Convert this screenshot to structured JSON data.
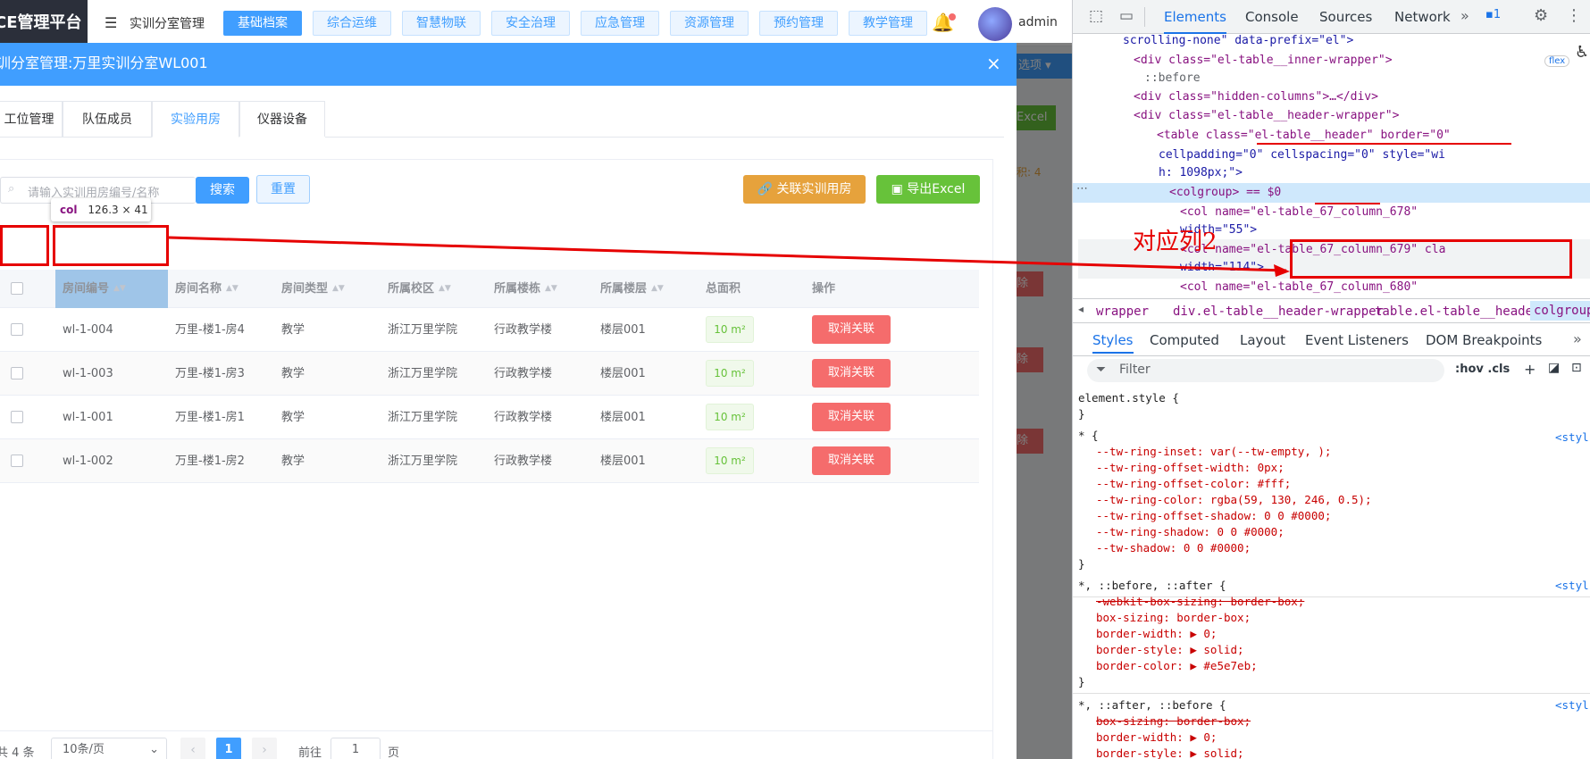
{
  "topbar": {
    "logo": "CE管理平台",
    "module": "实训分室管理",
    "nav": [
      "基础档案",
      "综合运维",
      "智慧物联",
      "安全治理",
      "应急管理",
      "资源管理",
      "预约管理",
      "教学管理"
    ],
    "user": "admin"
  },
  "dialog": {
    "title": "训分室管理:万里实训分室WL001",
    "tabs": [
      "工位管理",
      "队伍成员",
      "实验用房",
      "仪器设备"
    ],
    "active_tab": "实验用房"
  },
  "toolbar": {
    "search_placeholder": "请输入实训用房编号/名称",
    "search_label": "搜索",
    "reset_label": "重置",
    "link_label": "关联实训用房",
    "export_label": "导出Excel"
  },
  "tooltip": {
    "tag": "col",
    "size": "126.3 × 41"
  },
  "table": {
    "headers": [
      "房间编号",
      "房间名称",
      "房间类型",
      "所属校区",
      "所属楼栋",
      "所属楼层",
      "总面积",
      "操作"
    ],
    "rows": [
      {
        "code": "wl-1-004",
        "name": "万里-楼1-房4",
        "type": "教学",
        "campus": "浙江万里学院",
        "building": "行政教学楼",
        "floor": "楼层001",
        "area": "10 m²",
        "action": "取消关联"
      },
      {
        "code": "wl-1-003",
        "name": "万里-楼1-房3",
        "type": "教学",
        "campus": "浙江万里学院",
        "building": "行政教学楼",
        "floor": "楼层001",
        "area": "10 m²",
        "action": "取消关联"
      },
      {
        "code": "wl-1-001",
        "name": "万里-楼1-房1",
        "type": "教学",
        "campus": "浙江万里学院",
        "building": "行政教学楼",
        "floor": "楼层001",
        "area": "10 m²",
        "action": "取消关联"
      },
      {
        "code": "wl-1-002",
        "name": "万里-楼1-房2",
        "type": "教学",
        "campus": "浙江万里学院",
        "building": "行政教学楼",
        "floor": "楼层001",
        "area": "10 m²",
        "action": "取消关联"
      }
    ]
  },
  "pagination": {
    "total": "共 4 条",
    "page_size": "10条/页",
    "current": "1",
    "goto_label": "前往",
    "goto_value": "1",
    "page_unit": "页"
  },
  "background": {
    "options_label": "选项",
    "excel_label": "Excel",
    "delete_label": "除",
    "stat_text": "积: 4"
  },
  "annotation": {
    "text": "对应列2"
  },
  "devtools": {
    "tabs": [
      "Elements",
      "Console",
      "Sources",
      "Network"
    ],
    "issues": "1",
    "dom": [
      {
        "text": "scrolling-none\" data-prefix=\"el\">"
      },
      {
        "text": "<div class=\"el-table__inner-wrapper\">",
        "badge": "flex"
      },
      {
        "text": "::before"
      },
      {
        "text": "<div class=\"hidden-columns\">…</div>"
      },
      {
        "text": "<div class=\"el-table__header-wrapper\">"
      },
      {
        "text": "<table class=\"el-table__header\" border=\"0\""
      },
      {
        "text": "cellpadding=\"0\" cellspacing=\"0\" style=\"wi"
      },
      {
        "text": "h: 1098px;\">"
      },
      {
        "text": "<colgroup> == $0"
      },
      {
        "text": "<col name=\"el-table_67_column_678\""
      },
      {
        "text": "width=\"55\">"
      },
      {
        "text": "<col name=\"el-table_67_column_679\" cla"
      },
      {
        "text": "width=\"114\">"
      },
      {
        "text": "<col name=\"el-table_67_column_680\""
      }
    ],
    "breadcrumb": [
      "wrapper",
      "div.el-table__header-wrapper",
      "table.el-table__header",
      "colgroup"
    ],
    "subtabs": [
      "Styles",
      "Computed",
      "Layout",
      "Event Listeners",
      "DOM Breakpoints"
    ],
    "filter_placeholder": "Filter",
    "filter_tools": ":hov .cls",
    "styles_link": "<styl",
    "style_lines": [
      "element.style {",
      "}",
      "* {",
      "--tw-ring-inset: var(--tw-empty, );",
      "--tw-ring-offset-width: 0px;",
      "--tw-ring-offset-color: #fff;",
      "--tw-ring-color: rgba(59, 130, 246, 0.5);",
      "--tw-ring-offset-shadow: 0 0 #0000;",
      "--tw-ring-shadow: 0 0 #0000;",
      "--tw-shadow: 0 0 #0000;",
      "}",
      "*, ::before, ::after {",
      "-webkit-box-sizing: border-box;",
      "box-sizing: border-box;",
      "border-width: ▶ 0;",
      "border-style: ▶ solid;",
      "border-color: ▶ #e5e7eb;",
      "}",
      "*, ::after, ::before {",
      "box-sizing: border-box;",
      "border-width: ▶ 0;",
      "border-style: ▶ solid;"
    ]
  }
}
